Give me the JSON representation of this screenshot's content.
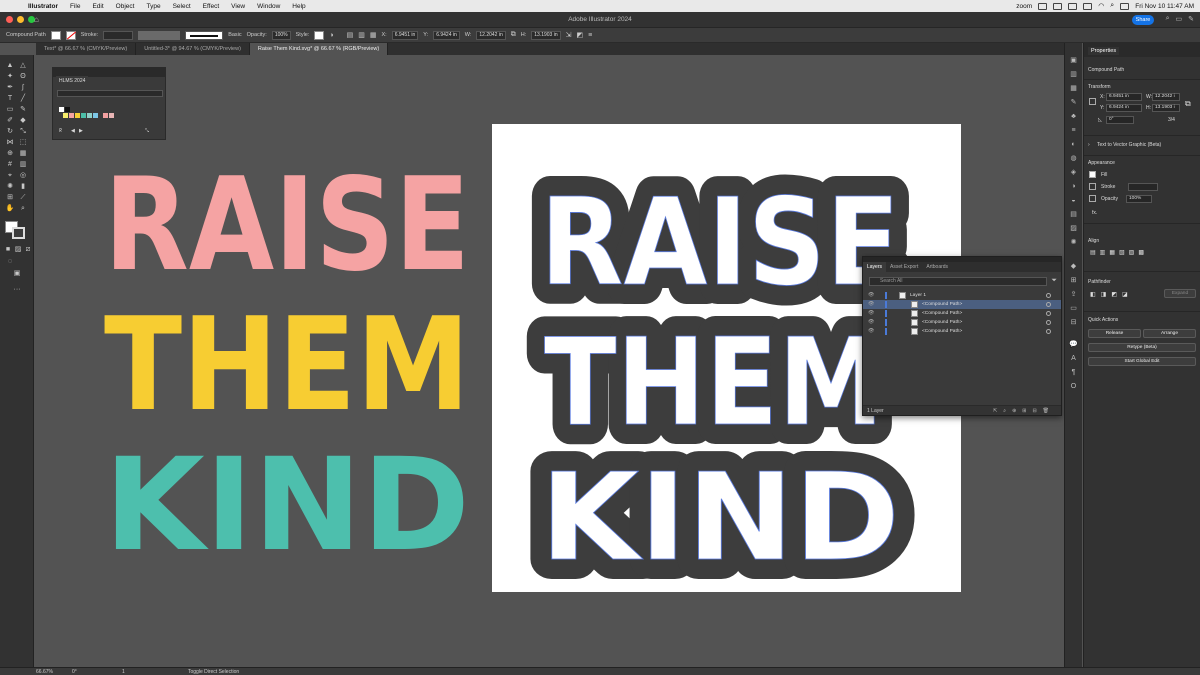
{
  "menubar": {
    "app": "Illustrator",
    "items": [
      "File",
      "Edit",
      "Object",
      "Type",
      "Select",
      "Effect",
      "View",
      "Window",
      "Help"
    ],
    "zoom": "zoom",
    "datetime": "Fri Nov 10  11:47 AM"
  },
  "titlebar": {
    "title": "Adobe Illustrator 2024",
    "share": "Share"
  },
  "controlbar": {
    "selection": "Compound Path",
    "stroke_label": "Stroke:",
    "brush": "Basic",
    "opacity_label": "Opacity:",
    "opacity": "100%",
    "style_label": "Style:",
    "x_label": "X:",
    "x": "6.9451 in",
    "y_label": "Y:",
    "y": "6.9424 in",
    "w_label": "W:",
    "w": "12.2042 in",
    "h_label": "H:",
    "h": "13.1903 in"
  },
  "tabs": [
    {
      "label": "Text* @ 66.67 % (CMYK/Preview)",
      "active": false
    },
    {
      "label": "Untitled-3* @ 94.67 % (CMYK/Preview)",
      "active": false
    },
    {
      "label": "Raise Them Kind.svg* @ 66.67 % (RGB/Preview)",
      "active": true
    }
  ],
  "swatch_panel": {
    "title": "HLMS 2024",
    "colors": [
      "#ffffff",
      "#111111",
      "#f6ec6a",
      "#f5a3a3",
      "#f5cd34",
      "#4cbfa8",
      "#8fd0c8",
      "#7cc7e6",
      "#f3a0a0",
      "#e9b5b5"
    ]
  },
  "artwork": {
    "lines": [
      "RAISE",
      "THEM",
      "KIND"
    ],
    "colors": [
      "#f5a3a3",
      "#f7cd32",
      "#4dbfad"
    ],
    "mono_fill": "#ffffff",
    "mono_outline": "#3d3d3d"
  },
  "layers_panel": {
    "tabs": [
      "Layers",
      "Asset Export",
      "Artboards"
    ],
    "search_placeholder": "Search All",
    "layer_name": "Layer 1",
    "items": [
      "<Compound Path>",
      "<Compound Path>",
      "<Compound Path>",
      "<Compound Path>"
    ],
    "footer": "1 Layer"
  },
  "properties": {
    "tab": "Properties",
    "selection": "Compound Path",
    "transform_title": "Transform",
    "x_label": "X:",
    "x": "6.9451 in",
    "y_label": "Y:",
    "y": "6.9424 in",
    "w_label": "W:",
    "w": "12.2042 i",
    "h_label": "H:",
    "h": "13.1903 i",
    "rotate": "0°",
    "ratio": "3/4",
    "text_to_vector": "Text to Vector Graphic (Beta)",
    "appearance_title": "Appearance",
    "fill_label": "Fill",
    "stroke_label": "Stroke",
    "opacity_label": "Opacity",
    "opacity": "100%",
    "fx": "fx.",
    "align_title": "Align",
    "pathfinder_title": "Pathfinder",
    "expand": "Expand",
    "quick_actions_title": "Quick Actions",
    "release": "Release",
    "arrange": "Arrange",
    "retype": "Retype (Beta)",
    "global_edit": "Start Global Edit"
  },
  "statusbar": {
    "zoom": "66.67%",
    "rotation": "0°",
    "artboard": "1",
    "tool": "Toggle Direct Selection"
  }
}
